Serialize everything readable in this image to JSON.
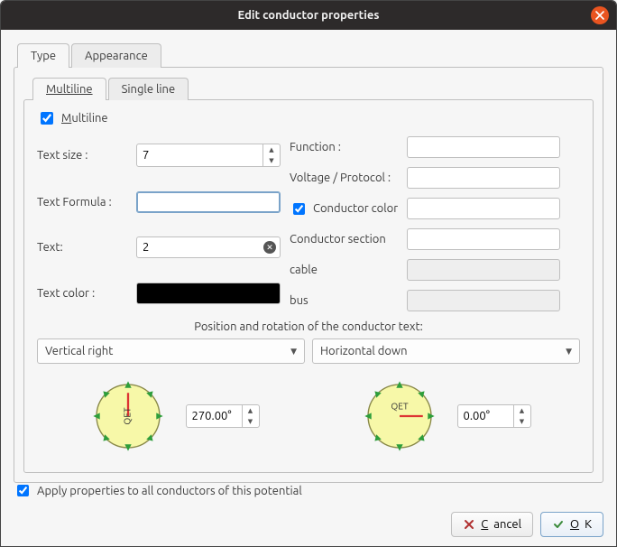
{
  "window": {
    "title": "Edit conductor properties"
  },
  "tabs": {
    "type": "Type",
    "appearance": "Appearance"
  },
  "subtabs": {
    "multiline": "Multiline",
    "singleline": "Single line"
  },
  "multiline": {
    "checkbox_label": "Multiline",
    "checkbox_checked": true,
    "text_size_label": "Text size :",
    "text_size_value": "7",
    "text_formula_label": "Text Formula :",
    "text_formula_value": "",
    "text_label": "Text:",
    "text_value": "2",
    "text_color_label": "Text color :",
    "text_color_value": "#000000",
    "function_label": "Function :",
    "function_value": "",
    "voltage_label": "Voltage / Protocol :",
    "voltage_value": "",
    "conductor_color_label": "Conductor color",
    "conductor_color_checked": true,
    "conductor_color_value": "",
    "conductor_section_label": "Conductor section",
    "conductor_section_value": "",
    "cable_label": "cable",
    "cable_value": "",
    "bus_label": "bus",
    "bus_value": ""
  },
  "rotation": {
    "section_title": "Position and rotation of the conductor text:",
    "vertical_label": "Vertical right",
    "vertical_value": "270.00°",
    "horizontal_label": "Horizontal down",
    "horizontal_value": "0.00°",
    "dial_text": "QET"
  },
  "footer": {
    "apply_label": "Apply properties to all conductors of this potential",
    "apply_checked": true,
    "cancel": "Cancel",
    "ok": "OK"
  }
}
